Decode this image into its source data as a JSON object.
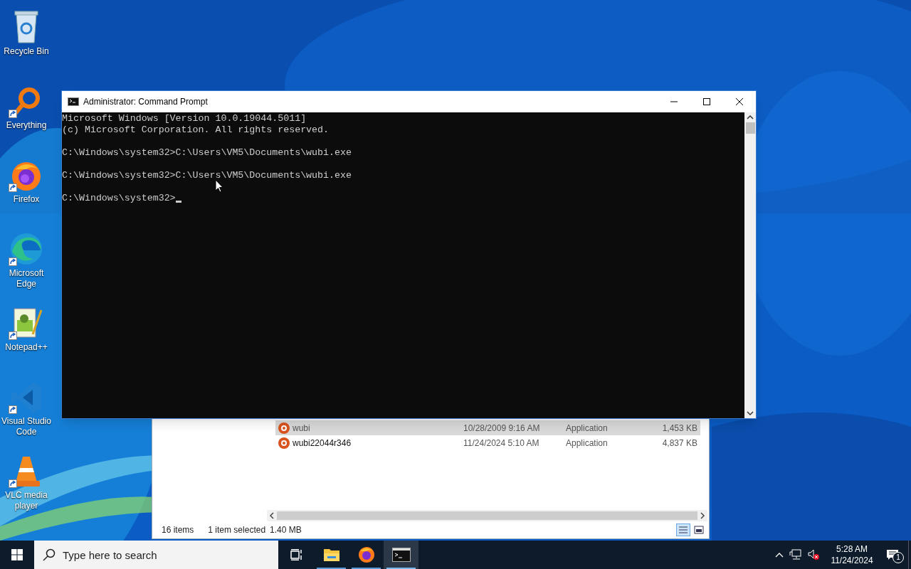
{
  "desktop_icons": [
    {
      "label": "Recycle Bin",
      "kind": "bin",
      "shortcut": false
    },
    {
      "label": "Everything",
      "kind": "search",
      "shortcut": true
    },
    {
      "label": "Firefox",
      "kind": "firefox",
      "shortcut": true
    },
    {
      "label": "Microsoft Edge",
      "kind": "edge",
      "shortcut": true
    },
    {
      "label": "Notepad++",
      "kind": "notepad",
      "shortcut": true
    },
    {
      "label": "Visual Studio Code",
      "kind": "vscode",
      "shortcut": true
    },
    {
      "label": "VLC media player",
      "kind": "vlc",
      "shortcut": true
    }
  ],
  "explorer": {
    "rows": [
      {
        "name": "wubi",
        "date": "10/28/2009 9:16 AM",
        "type": "Application",
        "size": "1,453 KB",
        "selected": true
      },
      {
        "name": "wubi22044r346",
        "date": "11/24/2024 5:10 AM",
        "type": "Application",
        "size": "4,837 KB",
        "selected": false
      }
    ],
    "status_bar": {
      "items": "16 items",
      "selection": "1 item selected",
      "size": "1.40 MB"
    }
  },
  "console_window": {
    "title": "Administrator: Command Prompt",
    "blocks": [
      [
        "Microsoft Windows [Version 10.0.19044.5011]",
        "(c) Microsoft Corporation. All rights reserved."
      ],
      [
        "C:\\Windows\\system32>C:\\Users\\VM5\\Documents\\wubi.exe"
      ],
      [
        "C:\\Windows\\system32>C:\\Users\\VM5\\Documents\\wubi.exe"
      ],
      [
        "C:\\Windows\\system32>"
      ]
    ]
  },
  "taskbar": {
    "search": {
      "placeholder": "Type here to search"
    },
    "apps": [
      {
        "kind": "taskview",
        "selected": false
      },
      {
        "kind": "folder",
        "selected": false
      },
      {
        "kind": "firefox",
        "selected": false
      },
      {
        "kind": "console",
        "selected": true
      }
    ],
    "clock": {
      "time": "5:28 AM",
      "date": "11/24/2024"
    },
    "notifications": "1"
  }
}
